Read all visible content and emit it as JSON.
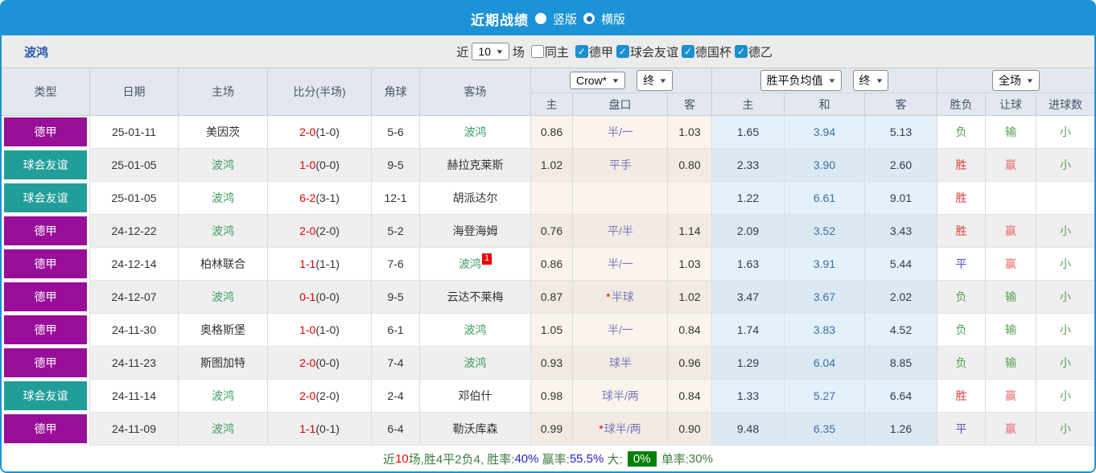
{
  "titlebar": {
    "title": "近期战绩",
    "radio_vertical": "竖版",
    "radio_horizontal": "横版",
    "selected": "横版"
  },
  "filterbar": {
    "team": "波鸿",
    "near_label": "近",
    "games_select": "10",
    "games_label": "场",
    "same_home_label": "同主",
    "same_home_checked": false,
    "leagues": [
      {
        "label": "德甲",
        "checked": true
      },
      {
        "label": "球会友谊",
        "checked": true
      },
      {
        "label": "德国杯",
        "checked": true
      },
      {
        "label": "德乙",
        "checked": true
      }
    ]
  },
  "table": {
    "static_headers": [
      "类型",
      "日期",
      "主场",
      "比分(半场)",
      "角球",
      "客场"
    ],
    "odds_group": {
      "select_company": "Crow*",
      "select_time": "终",
      "sub": [
        "主",
        "盘口",
        "客"
      ]
    },
    "avg_group": {
      "select_label": "胜平负均值",
      "select_time": "终",
      "sub": [
        "主",
        "和",
        "客"
      ]
    },
    "result_group": {
      "select_label": "全场",
      "sub": [
        "胜负",
        "让球",
        "进球数"
      ]
    },
    "rows": [
      {
        "type": "德甲",
        "date": "25-01-11",
        "home": "美因茨",
        "score_ft": "2-0",
        "score_ht": "(1-0)",
        "corner": "5-6",
        "away": "波鸿",
        "away_badge": "",
        "odds_home": "0.86",
        "handicap": "半/一",
        "odds_away": "1.03",
        "avg_home": "1.65",
        "avg_draw": "3.94",
        "avg_away": "5.13",
        "result": "负",
        "handicap_result": "输",
        "goals_result": "小"
      },
      {
        "type": "球会友谊",
        "date": "25-01-05",
        "home": "波鸿",
        "score_ft": "1-0",
        "score_ht": "(0-0)",
        "corner": "9-5",
        "away": "赫拉克莱斯",
        "away_badge": "",
        "odds_home": "1.02",
        "handicap": "平手",
        "odds_away": "0.80",
        "avg_home": "2.33",
        "avg_draw": "3.90",
        "avg_away": "2.60",
        "result": "胜",
        "handicap_result": "赢",
        "goals_result": "小"
      },
      {
        "type": "球会友谊",
        "date": "25-01-05",
        "home": "波鸿",
        "score_ft": "6-2",
        "score_ht": "(3-1)",
        "corner": "12-1",
        "away": "胡派达尔",
        "away_badge": "",
        "odds_home": "",
        "handicap": "",
        "odds_away": "",
        "avg_home": "1.22",
        "avg_draw": "6.61",
        "avg_away": "9.01",
        "result": "胜",
        "handicap_result": "",
        "goals_result": ""
      },
      {
        "type": "德甲",
        "date": "24-12-22",
        "home": "波鸿",
        "score_ft": "2-0",
        "score_ht": "(2-0)",
        "corner": "5-2",
        "away": "海登海姆",
        "away_badge": "",
        "odds_home": "0.76",
        "handicap": "平/半",
        "odds_away": "1.14",
        "avg_home": "2.09",
        "avg_draw": "3.52",
        "avg_away": "3.43",
        "result": "胜",
        "handicap_result": "赢",
        "goals_result": "小"
      },
      {
        "type": "德甲",
        "date": "24-12-14",
        "home": "柏林联合",
        "score_ft": "1-1",
        "score_ht": "(1-1)",
        "corner": "7-6",
        "away": "波鸿",
        "away_badge": "1",
        "odds_home": "0.86",
        "handicap": "半/一",
        "odds_away": "1.03",
        "avg_home": "1.63",
        "avg_draw": "3.91",
        "avg_away": "5.44",
        "result": "平",
        "handicap_result": "赢",
        "goals_result": "小"
      },
      {
        "type": "德甲",
        "date": "24-12-07",
        "home": "波鸿",
        "score_ft": "0-1",
        "score_ht": "(0-0)",
        "corner": "9-5",
        "away": "云达不莱梅",
        "away_badge": "",
        "odds_home": "0.87",
        "handicap": "*半球",
        "odds_away": "1.02",
        "avg_home": "3.47",
        "avg_draw": "3.67",
        "avg_away": "2.02",
        "result": "负",
        "handicap_result": "输",
        "goals_result": "小"
      },
      {
        "type": "德甲",
        "date": "24-11-30",
        "home": "奥格斯堡",
        "score_ft": "1-0",
        "score_ht": "(1-0)",
        "corner": "6-1",
        "away": "波鸿",
        "away_badge": "",
        "odds_home": "1.05",
        "handicap": "半/一",
        "odds_away": "0.84",
        "avg_home": "1.74",
        "avg_draw": "3.83",
        "avg_away": "4.52",
        "result": "负",
        "handicap_result": "输",
        "goals_result": "小"
      },
      {
        "type": "德甲",
        "date": "24-11-23",
        "home": "斯图加特",
        "score_ft": "2-0",
        "score_ht": "(0-0)",
        "corner": "7-4",
        "away": "波鸿",
        "away_badge": "",
        "odds_home": "0.93",
        "handicap": "球半",
        "odds_away": "0.96",
        "avg_home": "1.29",
        "avg_draw": "6.04",
        "avg_away": "8.85",
        "result": "负",
        "handicap_result": "输",
        "goals_result": "小"
      },
      {
        "type": "球会友谊",
        "date": "24-11-14",
        "home": "波鸿",
        "score_ft": "2-0",
        "score_ht": "(2-0)",
        "corner": "2-4",
        "away": "邓伯什",
        "away_badge": "",
        "odds_home": "0.98",
        "handicap": "球半/两",
        "odds_away": "0.84",
        "avg_home": "1.33",
        "avg_draw": "5.27",
        "avg_away": "6.64",
        "result": "胜",
        "handicap_result": "赢",
        "goals_result": "小"
      },
      {
        "type": "德甲",
        "date": "24-11-09",
        "home": "波鸿",
        "score_ft": "1-1",
        "score_ht": "(0-1)",
        "corner": "6-4",
        "away": "勒沃库森",
        "away_badge": "",
        "odds_home": "0.99",
        "handicap": "*球半/两",
        "odds_away": "0.90",
        "avg_home": "9.48",
        "avg_draw": "6.35",
        "avg_away": "1.26",
        "result": "平",
        "handicap_result": "赢",
        "goals_result": "小"
      }
    ]
  },
  "footer": {
    "segments": [
      {
        "text": "近",
        "color": "green"
      },
      {
        "text": "10",
        "color": "red"
      },
      {
        "text": "场,胜4平2负4, 胜率:",
        "color": "green"
      },
      {
        "text": "40%",
        "color": "blue"
      },
      {
        "text": " 赢率:",
        "color": "green"
      },
      {
        "text": "55.5%",
        "color": "blue"
      },
      {
        "text": " 大: ",
        "color": "green"
      },
      {
        "text": "0%",
        "color": "box"
      },
      {
        "text": " 单率:",
        "color": "green"
      },
      {
        "text": "30%",
        "color": "green"
      }
    ]
  },
  "colors": {
    "topbar": "#1b93d6",
    "accent_checkbox": "#1a8fd1",
    "type_colors": {
      "德甲": "#990e99",
      "球会友谊": "#219e97"
    },
    "team_link": "#3f9e63",
    "score_red": "#e60000",
    "handicap_text": "#7878bc",
    "avg_draw_text": "#3a6fa8",
    "win": "#e23b3b",
    "draw": "#5050cc",
    "lose": "#55a055",
    "footer_box_bg": "#008000"
  }
}
